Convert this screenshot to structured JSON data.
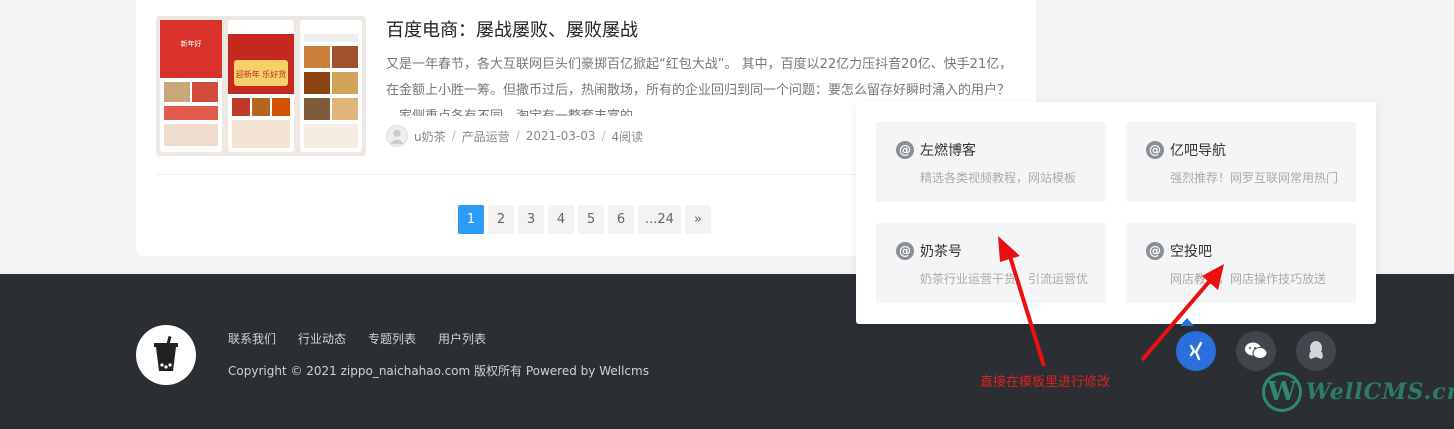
{
  "post": {
    "title": "百度电商：屡战屡败、屡败屡战",
    "excerpt": "又是一年春节，各大互联网巨头们豪掷百亿掀起“红包大战”。 其中，百度以22亿力压抖音20亿、快手21亿，在金额上小胜一筹。但撒币过后，热闹散场，所有的企业回归到同一个问题：要怎么留存好瞬时涌入的用户？ …家侧重点各有不同，淘宝有一整套丰富的",
    "author": "u奶茶",
    "category": "产品运营",
    "date": "2021-03-03",
    "reads": "4阅读",
    "thumb_texts": {
      "t1": "新年好",
      "t2": "迎新年 乐好货"
    }
  },
  "pagination": [
    "1",
    "2",
    "3",
    "4",
    "5",
    "6",
    "...24",
    "»"
  ],
  "friend_links": [
    {
      "name": "左燃博客",
      "desc": "精选各类视频教程，网站模板"
    },
    {
      "name": "亿吧导航",
      "desc": "强烈推荐！网罗互联网常用热门"
    },
    {
      "name": "奶茶号",
      "desc": "奶茶行业运营干货，引流运营优"
    },
    {
      "name": "空投吧",
      "desc": "网店教程，网店操作技巧放送"
    }
  ],
  "footer": {
    "links": [
      "联系我们",
      "行业动态",
      "专题列表",
      "用户列表"
    ],
    "copyright": "Copyright © 2021 zippo_naichahao.com 版权所有 Powered by Wellcms"
  },
  "annotation": "直接在模板里进行修改",
  "watermark": {
    "letter": "W",
    "text": "WellCMS.cn"
  },
  "icons": [
    "xing-icon",
    "wechat-icon",
    "qq-icon"
  ],
  "colors": {
    "accent": "#2d9af5",
    "footer_bg": "#2b2f33",
    "annotation": "#e02020"
  }
}
